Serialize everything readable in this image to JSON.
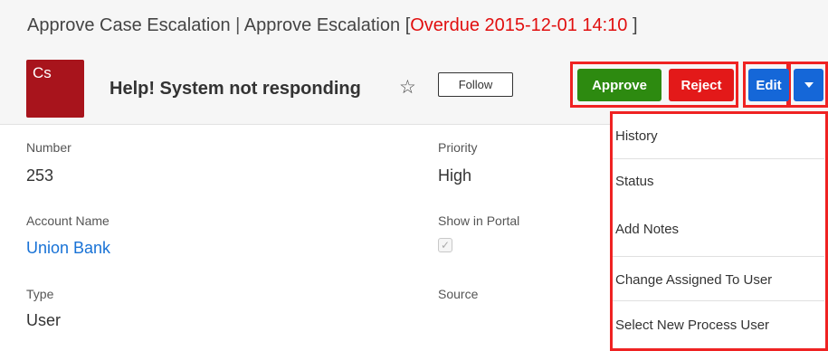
{
  "header": {
    "title_main": "Approve Case Escalation",
    "separator": "|",
    "title_sub": "Approve Escalation",
    "bracket_open": "[",
    "overdue_text": "Overdue 2015-12-01 14:10",
    "bracket_close": "]"
  },
  "record": {
    "avatar_text": "Cs",
    "avatar_color": "#a8141c",
    "name": "Help! System not responding",
    "favorite_icon": "star-outline-icon",
    "favorite_glyph": "☆",
    "follow_label": "Follow"
  },
  "actions": {
    "approve_label": "Approve",
    "reject_label": "Reject",
    "edit_label": "Edit",
    "caret_icon": "caret-down-icon",
    "approve_color": "#2d8a10",
    "reject_color": "#e31919",
    "edit_color": "#1567d8",
    "highlight_color": "#ef2222"
  },
  "fields": {
    "number": {
      "label": "Number",
      "value": "253"
    },
    "priority": {
      "label": "Priority",
      "value": "High"
    },
    "account_name": {
      "label": "Account Name",
      "value": "Union Bank"
    },
    "show_in_portal": {
      "label": "Show in Portal",
      "checked": true,
      "glyph": "✓"
    },
    "type": {
      "label": "Type",
      "value": "User"
    },
    "source": {
      "label": "Source",
      "value": ""
    }
  },
  "dropdown": {
    "items": [
      {
        "label": "History"
      },
      {
        "label": "Status"
      },
      {
        "label": "Add Notes"
      },
      {
        "label": "Change Assigned To User"
      },
      {
        "label": "Select New Process User"
      }
    ]
  }
}
